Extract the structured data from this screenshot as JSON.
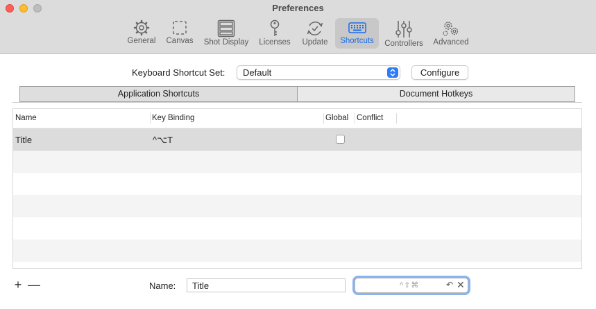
{
  "window": {
    "title": "Preferences"
  },
  "toolbar": {
    "items": [
      {
        "label": "General",
        "icon": "gear-icon"
      },
      {
        "label": "Canvas",
        "icon": "canvas-icon"
      },
      {
        "label": "Shot Display",
        "icon": "shot-display-icon"
      },
      {
        "label": "Licenses",
        "icon": "key-icon"
      },
      {
        "label": "Update",
        "icon": "update-icon"
      },
      {
        "label": "Shortcuts",
        "icon": "keyboard-icon",
        "selected": true
      },
      {
        "label": "Controllers",
        "icon": "sliders-icon"
      },
      {
        "label": "Advanced",
        "icon": "gears-icon"
      }
    ]
  },
  "shortcut_set": {
    "label": "Keyboard Shortcut Set:",
    "value": "Default",
    "configure_label": "Configure"
  },
  "tabs": [
    {
      "label": "Application Shortcuts",
      "selected": true
    },
    {
      "label": "Document Hotkeys"
    }
  ],
  "table": {
    "columns": [
      "Name",
      "Key Binding",
      "Global",
      "Conflict"
    ],
    "rows": [
      {
        "name": "Title",
        "binding": "^⌥T",
        "global": false
      }
    ]
  },
  "footer": {
    "add_label": "+",
    "remove_label": "—",
    "name_label": "Name:",
    "name_value": "Title",
    "recorder_placeholder": "^⇧⌘",
    "recorder_undo": "↶",
    "recorder_clear": "✕"
  },
  "colors": {
    "accent": "#1a6ce8",
    "selection": "#dcdcdc"
  }
}
